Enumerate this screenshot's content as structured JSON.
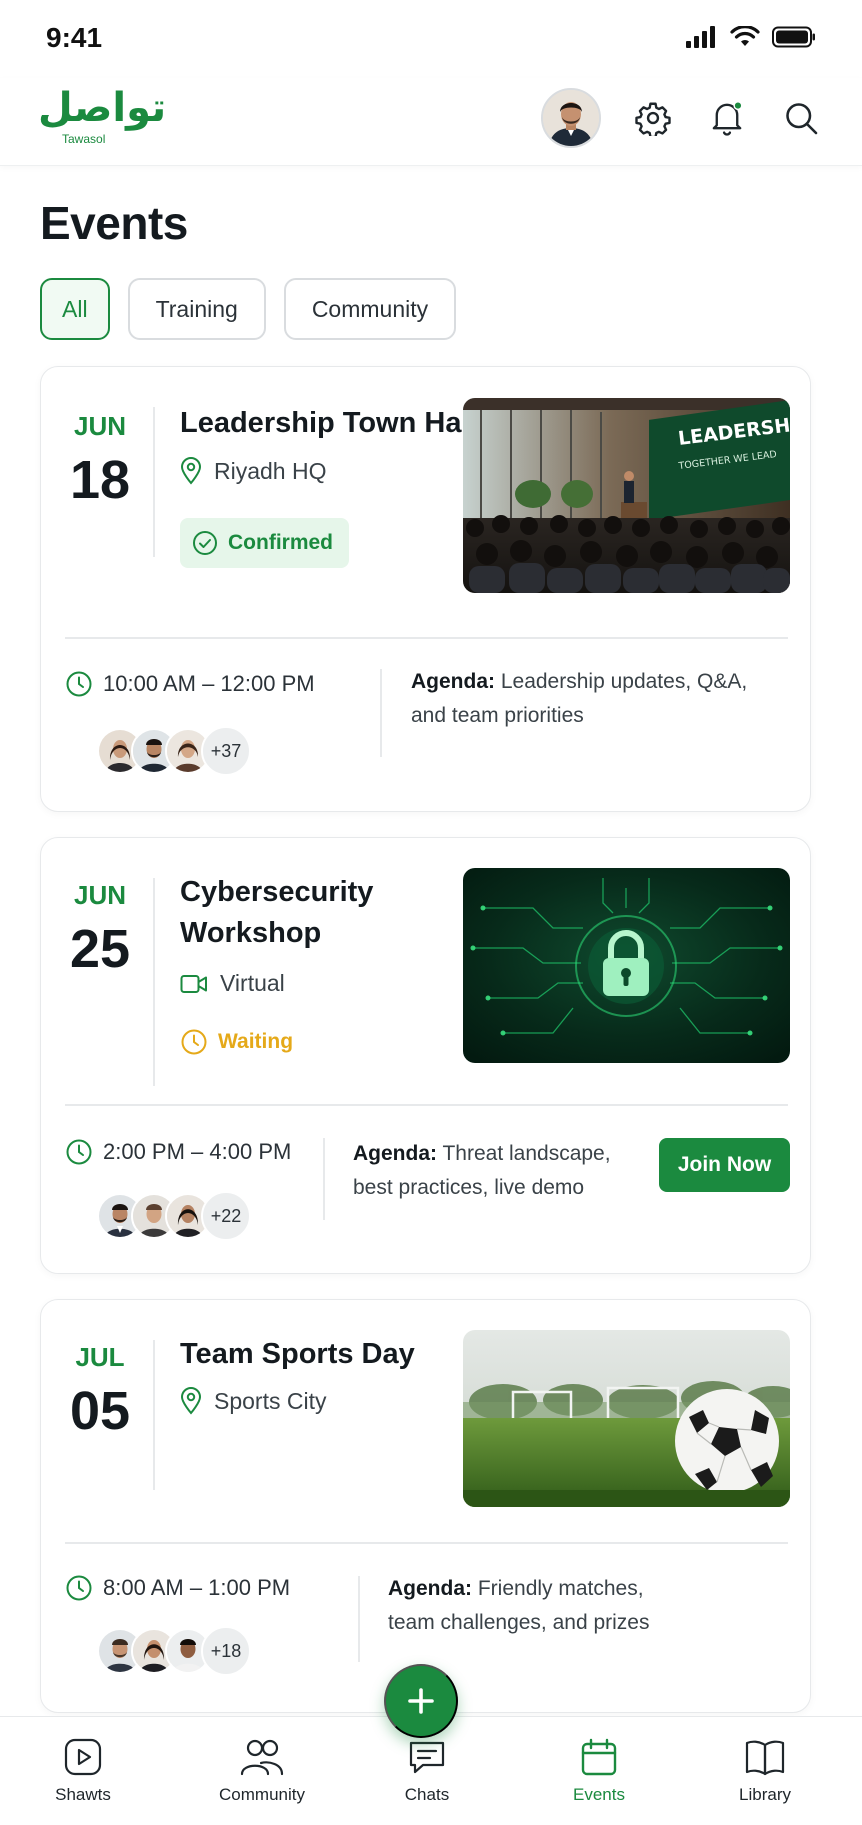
{
  "status_bar": {
    "time": "9:41"
  },
  "header": {
    "logo_arabic": "تواصل",
    "logo_english": "Tawasol",
    "icons": [
      "avatar",
      "gear-icon",
      "bell-icon",
      "search-icon"
    ]
  },
  "page": {
    "title": "Events"
  },
  "filters": [
    {
      "label": "All",
      "active": true
    },
    {
      "label": "Training",
      "active": false
    },
    {
      "label": "Community",
      "active": false
    }
  ],
  "events": [
    {
      "month": "JUN",
      "day": "18",
      "title": "Leadership Town Hall",
      "location_icon": "pin-icon",
      "location": "Riyadh HQ",
      "status": "Confirmed",
      "status_icon": "check-circle-icon",
      "image_text_main": "LEADERSHIP",
      "image_text_sub": "TOGETHER WE LEAD",
      "time": "10:00 AM – 12:00 PM",
      "attendees_more": "+37",
      "agenda_label": "Agenda:",
      "agenda_line1": "Leadership updates, Q&A,",
      "agenda_line2": "and team priorities"
    },
    {
      "month": "JUN",
      "day": "25",
      "title_line1": "Cybersecurity",
      "title_line2": "Workshop",
      "location_icon": "video-icon",
      "location": "Virtual",
      "status": "Waiting",
      "status_icon": "clock-icon",
      "time": "2:00 PM – 4:00 PM",
      "attendees_more": "+22",
      "agenda_label": "Agenda:",
      "agenda_line1": "Threat landscape,",
      "agenda_line2": "best practices, live demo",
      "action": "Join Now"
    },
    {
      "month": "JUL",
      "day": "05",
      "title": "Team Sports Day",
      "location_icon": "pin-icon",
      "location": "Sports City",
      "time": "8:00 AM – 1:00 PM",
      "attendees_more": "+18",
      "agenda_label": "Agenda:",
      "agenda_line1": "Friendly matches,",
      "agenda_line2": "team challenges, and prizes"
    }
  ],
  "fab": {
    "icon": "plus-icon"
  },
  "bottom_nav": [
    {
      "label": "Shawts",
      "icon": "play-icon",
      "active": false
    },
    {
      "label": "Community",
      "icon": "people-icon",
      "active": false
    },
    {
      "label": "Chats",
      "icon": "chat-icon",
      "active": false
    },
    {
      "label": "Events",
      "icon": "calendar-icon",
      "active": true
    },
    {
      "label": "Library",
      "icon": "book-icon",
      "active": false
    }
  ],
  "colors": {
    "accent": "#1b8a3f",
    "waiting": "#e5a919",
    "text": "#141a1f",
    "border": "#e7e9eb"
  }
}
